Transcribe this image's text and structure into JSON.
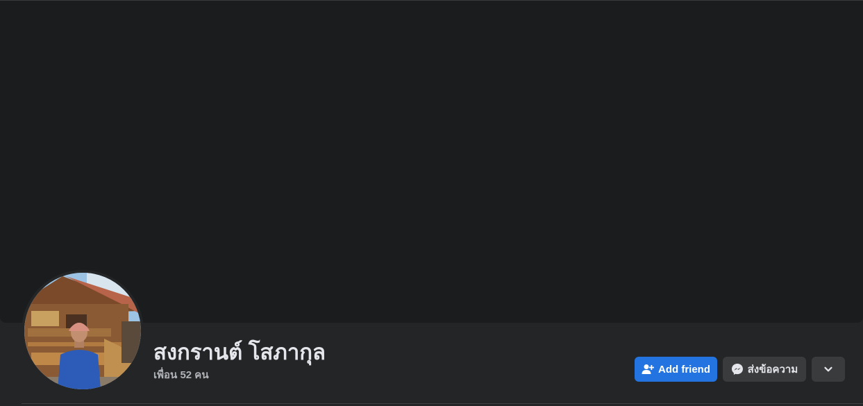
{
  "profile": {
    "name": "สงกรานต์ โสภากุล",
    "friends_count": "เพื่อน 52 คน"
  },
  "actions": {
    "add_friend_label": "Add friend",
    "message_label": "ส่งข้อความ",
    "more_icon": "chevron-down-icon"
  },
  "colors": {
    "primary": "#2374e1",
    "background": "#242526",
    "cover": "#1b1c1e",
    "secondary_button": "#3a3b3c",
    "text_primary": "#e4e6eb",
    "text_secondary": "#b0b3b8"
  }
}
